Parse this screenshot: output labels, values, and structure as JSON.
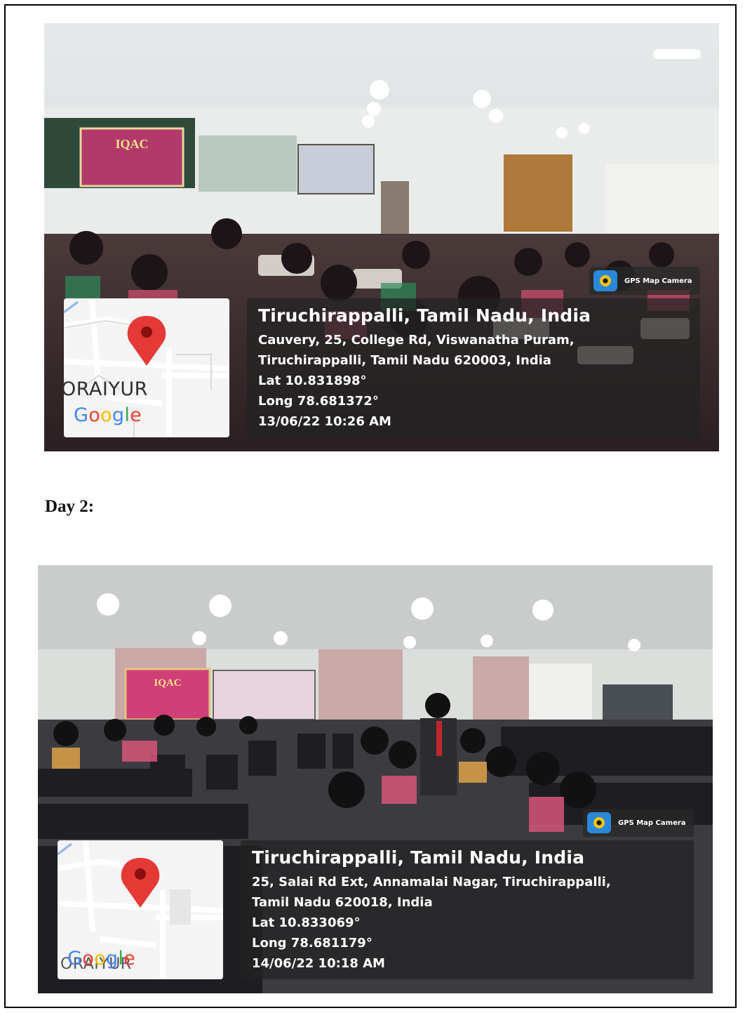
{
  "day_heading": "Day 2:",
  "photos": [
    {
      "banner_title": "IQAC",
      "gps_badge": "GPS Map Camera",
      "map_place": "ORAIYUR",
      "map_logo": "Google",
      "city": "Tiruchirappalli, Tamil Nadu, India",
      "address_line1": "Cauvery, 25, College Rd, Viswanatha Puram,",
      "address_line2": "Tiruchirappalli, Tamil Nadu 620003, India",
      "lat": "Lat 10.831898°",
      "long": "Long 78.681372°",
      "datetime": "13/06/22 10:26 AM"
    },
    {
      "banner_title": "IQAC",
      "gps_badge": "GPS Map Camera",
      "map_place": "ORAIYUR",
      "map_logo": "Google",
      "city": "Tiruchirappalli, Tamil Nadu, India",
      "address_line1": "25, Salai Rd Ext, Annamalai Nagar, Tiruchirappalli,",
      "address_line2": "Tamil Nadu 620018, India",
      "lat": "Lat 10.833069°",
      "long": "Long 78.681179°",
      "datetime": "14/06/22 10:18 AM"
    }
  ],
  "colors": {
    "overlay": "#232323",
    "pin": "#e53935",
    "google_blue": "#4285f4",
    "google_red": "#ea4335",
    "google_yellow": "#fbbc05",
    "google_green": "#34a853"
  }
}
